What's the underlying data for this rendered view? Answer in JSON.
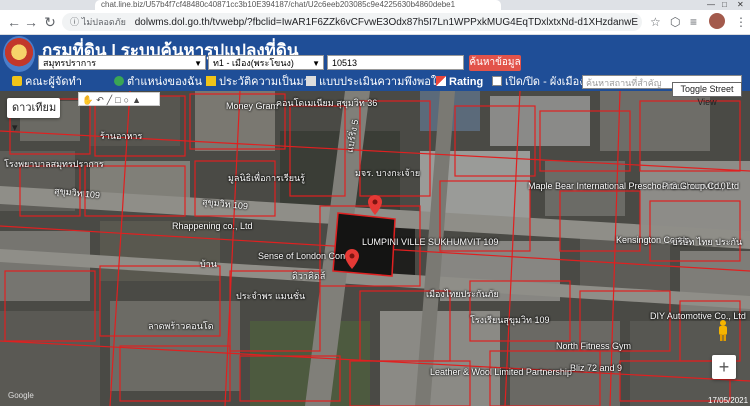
{
  "browser": {
    "tab_title": "chat.line.biz/U57b4f7cf48480c40871cc3b10E394187/chat/U2c6eeb203085c9e4225630b4860debe1",
    "not_secure_label": "ไม่ปลอดภัย",
    "url": "dolwms.dol.go.th/tvwebp/?fbclid=IwAR1F6ZZk6vCFvwE3Odx87h5I7Ln1WPPxkMUG4EqTDxlxtxNd-d1XHzdanwE",
    "back_icon": "back-arrow-icon",
    "forward_icon": "forward-arrow-icon",
    "reload_icon": "reload-icon"
  },
  "header": {
    "title": "กรมที่ดิน | ระบบค้นหารูปแปลงที่ดิน",
    "province_select": "สมุทรปราการ",
    "district_select": "ท1 - เมือง(พระโขนง)",
    "parcel_input": "10513",
    "search_button": "ค้นหาข้อมูล"
  },
  "toolbar": {
    "items": [
      {
        "label": "คณะผู้จัดทำ",
        "icon": "people-icon"
      },
      {
        "label": "ตำแหน่งของฉัน",
        "icon": "globe-icon"
      },
      {
        "label": "ประวัติความเป็นมา",
        "icon": "history-icon"
      },
      {
        "label": "แบบประเมินความพึงพอใจ",
        "icon": "form-icon"
      },
      {
        "label": "Rating",
        "icon": "chart-icon"
      },
      {
        "label": "เปิด/ปิด - ผังเมือง",
        "icon": "checkbox-icon"
      }
    ],
    "search_placeholder": "ค้นหาสถานที่สำคัญ"
  },
  "map": {
    "map_type": "ดาวเทียม",
    "toggle_street_view": "Toggle Street View",
    "zoom_in": "+",
    "labels": [
      "Money Gram",
      "คอนโดเมเนียม สุขุมวิท 36",
      "แบร์ริ่ง 5",
      "ร้านอาหาร",
      "สุขุมวิท 109",
      "โรงพยาบาลสมุทรปราการ",
      "Rhappening co., Ltd",
      "สุขุมวิท 109",
      "มูลนิธิเพื่อการเรียนรู้",
      "มจร. บางกะเจ้าย",
      "Maple Bear International Preschool Sukhumvit 107",
      "Pita Group Co., Ltd",
      "Sense of London Condo",
      "LUMPINI VILLE SUKHUMVIT 109",
      "Kensington Condo",
      "บริษัท ไทย ประกัน",
      "ดิวาคิดส์",
      "ประจำพร แมนชั่น",
      "DIY Automotive Co., Ltd",
      "เมืองไทยประกันภัย",
      "North Fitness Gym",
      "Bliz 72 and 9",
      "Leather & Wool Limited Partnership",
      "ลาดพร้าวคอนโด",
      "โรงเรียนสุขุมวิท 109",
      "บ้าน"
    ],
    "date_display": "17/05/2021"
  }
}
